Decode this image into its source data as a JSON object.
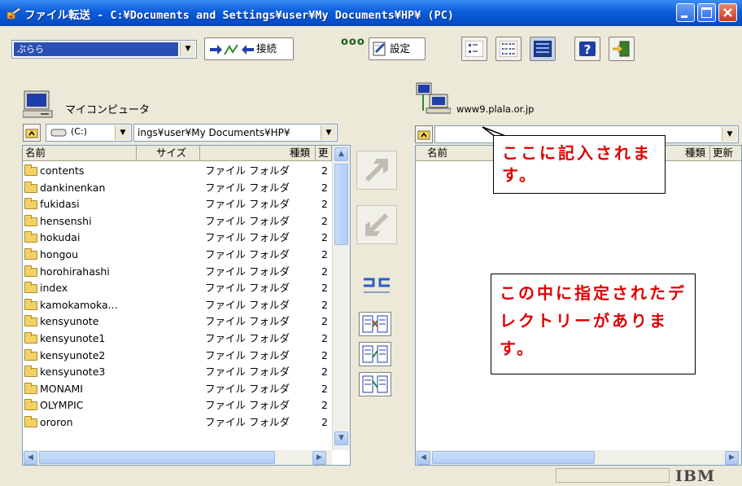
{
  "window": {
    "title": "ファイル転送 - C:¥Documents and Settings¥user¥My Documents¥HP¥ (PC)"
  },
  "toolbar": {
    "connection_combo_value": "ぷらら",
    "connect_label": "接続",
    "dots": "ooo",
    "settings_label": "設定"
  },
  "local": {
    "heading": "マイコンピュータ",
    "drive_label": "(C:)",
    "path_value": "ings¥user¥My Documents¥HP¥",
    "columns": [
      "名前",
      "サイズ",
      "種類",
      "更"
    ],
    "files": [
      {
        "name": "contents",
        "type": "ファイル フォルダ",
        "x": "2"
      },
      {
        "name": "dankinenkan",
        "type": "ファイル フォルダ",
        "x": "2"
      },
      {
        "name": "fukidasi",
        "type": "ファイル フォルダ",
        "x": "2"
      },
      {
        "name": "hensenshi",
        "type": "ファイル フォルダ",
        "x": "2"
      },
      {
        "name": "hokudai",
        "type": "ファイル フォルダ",
        "x": "2"
      },
      {
        "name": "hongou",
        "type": "ファイル フォルダ",
        "x": "2"
      },
      {
        "name": "horohirahashi",
        "type": "ファイル フォルダ",
        "x": "2"
      },
      {
        "name": "index",
        "type": "ファイル フォルダ",
        "x": "2"
      },
      {
        "name": "kamokamoka...",
        "type": "ファイル フォルダ",
        "x": "2"
      },
      {
        "name": "kensyunote",
        "type": "ファイル フォルダ",
        "x": "2"
      },
      {
        "name": "kensyunote1",
        "type": "ファイル フォルダ",
        "x": "2"
      },
      {
        "name": "kensyunote2",
        "type": "ファイル フォルダ",
        "x": "2"
      },
      {
        "name": "kensyunote3",
        "type": "ファイル フォルダ",
        "x": "2"
      },
      {
        "name": "MONAMI",
        "type": "ファイル フォルダ",
        "x": "2"
      },
      {
        "name": "OLYMPIC",
        "type": "ファイル フォルダ",
        "x": "2"
      },
      {
        "name": "ororon",
        "type": "ファイル フォルダ",
        "x": "2"
      }
    ]
  },
  "remote": {
    "heading": "www9.plala.or.jp",
    "path_value": "",
    "columns": [
      "名前",
      "種類",
      "更新"
    ]
  },
  "callouts": {
    "path": "ここに記入されます。",
    "list": "この中に指定されたデレクトリーがあります。"
  },
  "status": {
    "brand": "IBM"
  }
}
